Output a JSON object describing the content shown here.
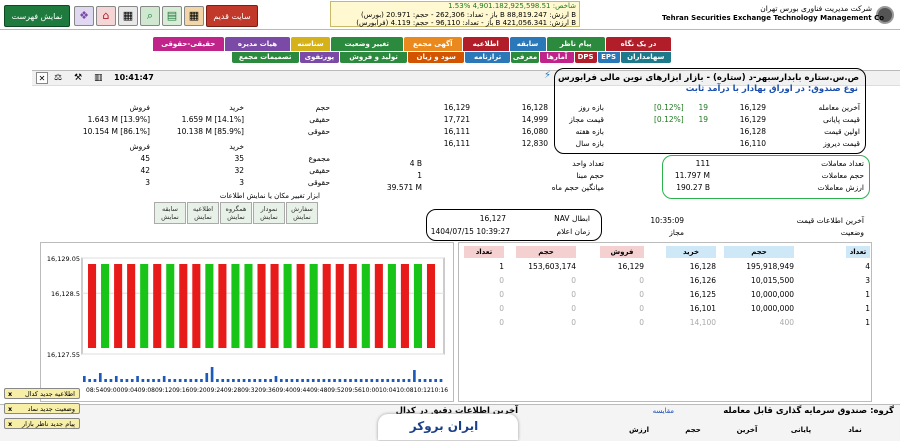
{
  "header": {
    "org_fa": "شرکت مدیریت فناوری بورس تهران",
    "org_en": "Tehran Securities Exchange Technology Management Co",
    "index_lines": [
      "شاخص: 4,901.182,925,598.51 %1.53",
      "(بورس) باز - تعداد: 262,306 - حجم: 20.971 B ارزش: 88,819.247 B",
      "(فرابورس) باز - تعداد: 96,110 - حجم: 4.119 B ارزش: 421,056.341 B"
    ],
    "old_site_label": "سایت قدیم",
    "show_list_label": "نمایش فهرست"
  },
  "tabs_row1": [
    {
      "label": "در یک نگاه",
      "color": "#b11e2a"
    },
    {
      "label": "پیام ناظر",
      "color": "#2b8a3e"
    },
    {
      "label": "سابقه",
      "color": "#2a78b8"
    },
    {
      "label": "اطلاعیه",
      "color": "#b11e2a"
    },
    {
      "label": "آگهی مجمع",
      "color": "#ea8a1e"
    },
    {
      "label": "تغییر وضعیت",
      "color": "#2b8a3e"
    },
    {
      "label": "سناسنه",
      "color": "#d6b21a"
    },
    {
      "label": "هیات مدیره",
      "color": "#7a4aa6"
    },
    {
      "label": "حقیقی-حقوقی",
      "color": "#c0238a"
    }
  ],
  "tabs_row2": [
    {
      "label": "سهامداران",
      "color": "#1e7a8a"
    },
    {
      "label": "EPS",
      "color": "#2a78b8"
    },
    {
      "label": "DPS",
      "color": "#b11e2a"
    },
    {
      "label": "آمارها",
      "color": "#c0238a"
    },
    {
      "label": "معرفی",
      "color": "#2b8a3e"
    },
    {
      "label": "ترازنامه",
      "color": "#2a78b8"
    },
    {
      "label": "سود و زیان",
      "color": "#d35400"
    },
    {
      "label": "تولید و فروش",
      "color": "#2b8a3e"
    },
    {
      "label": "پورتفوی",
      "color": "#7a4aa6"
    },
    {
      "label": "تصمیمات مجمع",
      "color": "#2b8a3e"
    }
  ],
  "time": "10:41:47",
  "title": "ص.س.ستاره بابدارسبهر-د (ستاره) - بازار ابزارهای نوین مالی فرابورس",
  "fund_type": "نوع صندوق: در اوراق بهادار با درآمد ثابت",
  "prices": {
    "last_trade_label": "آخرین معامله",
    "last_trade": "16,129",
    "last_trade_change": "19",
    "last_trade_pct": "[0.12%]",
    "closing_label": "قیمت پایانی",
    "closing": "16,129",
    "closing_change": "19",
    "closing_pct": "[0.12%]",
    "first_label": "اولین قیمت",
    "first": "16,128",
    "yesterday_label": "قیمت دیروز",
    "yesterday": "16,110",
    "day_range_label": "بازه روز",
    "day_range_low": "16,128",
    "day_range_high": "16,129",
    "allowed_label": "قیمت مجاز",
    "allowed_low": "14,999",
    "allowed_high": "17,721",
    "week_label": "بازه هفته",
    "week_low": "16,080",
    "week_high": "16,111",
    "year_label": "بازه سال",
    "year_low": "12,830",
    "year_high": "16,111"
  },
  "stats": {
    "count_label": "تعداد معاملات",
    "count": "111",
    "volume_label": "حجم معاملات",
    "volume": "11.797 M",
    "value_label": "ارزش معاملات",
    "value": "190.27 B",
    "unit_label": "تعداد واحد",
    "unit": "4 B",
    "base_label": "حجم مبنا",
    "base": "1",
    "avg_label": "میانگین حجم ماه",
    "avg": "39.571 M"
  },
  "nav": {
    "last_info_label": "آخرین اطلاعات قیمت",
    "last_info_time": "10:35:09",
    "status_label": "وضعیت",
    "status": "مجاز",
    "nav_label": "NAV ابطال",
    "nav": "16,127",
    "nav_time_label": "زمان اعلام",
    "nav_time": "1404/07/15 10:39:27"
  },
  "client": {
    "headers": [
      "حجم",
      "خرید",
      "فروش"
    ],
    "rows": [
      {
        "label": "حقیقی",
        "buy": "1.659 M [14.1%]",
        "sell": "1.643 M [13.9%]"
      },
      {
        "label": "حقوقی",
        "buy": "10.138 M [85.9%]",
        "sell": "10.154 M [86.1%]"
      }
    ],
    "count_headers": [
      "تعداد",
      "خرید",
      "فروش"
    ],
    "count_rows": [
      {
        "label": "مجموع",
        "buy": "35",
        "sell": "45"
      },
      {
        "label": "حقیقی",
        "buy": "32",
        "sell": "42"
      },
      {
        "label": "حقوقی",
        "buy": "3",
        "sell": "3"
      }
    ]
  },
  "option_hint": "ابزار تغییر مکان یا نمایش اطلاعات",
  "options": [
    {
      "label": "سفارش",
      "action": "نمایش"
    },
    {
      "label": "نمودار",
      "action": "نمایش"
    },
    {
      "label": "همگروه",
      "action": "نمایش"
    },
    {
      "label": "اطلاعیه",
      "action": "نمایش"
    },
    {
      "label": "سابقه",
      "action": "نمایش"
    }
  ],
  "orderbook": {
    "headers": [
      "تعداد",
      "حجم",
      "خرید",
      "فروش",
      "حجم",
      "تعداد"
    ],
    "rows": [
      [
        "4",
        "195,918,949",
        "16,128",
        "16,129",
        "153,603,174",
        "1"
      ],
      [
        "3",
        "10,015,500",
        "16,126",
        "0",
        "0",
        "0"
      ],
      [
        "1",
        "10,000,000",
        "16,125",
        "0",
        "0",
        "0"
      ],
      [
        "1",
        "10,000,000",
        "16,101",
        "0",
        "0",
        "0"
      ],
      [
        "1",
        "400",
        "14,100",
        "0",
        "0",
        "0"
      ]
    ]
  },
  "chart_data": {
    "type": "bar",
    "ylim": [
      16127.55,
      16129.05
    ],
    "yticks": [
      "16,129.05",
      "16,128.5",
      "16,127.55"
    ],
    "xticks": [
      "08:54",
      "09:00",
      "09:04",
      "09:08",
      "09:12",
      "09:16",
      "09:20",
      "09:24",
      "09:28",
      "09:32",
      "09:36",
      "09:40",
      "09:44",
      "09:48",
      "09:52",
      "09:56",
      "10:00",
      "10:04",
      "10:08",
      "10:12",
      "10:16"
    ],
    "candle_colors": [
      "red",
      "green",
      "red",
      "red",
      "green",
      "red",
      "green",
      "red",
      "red",
      "green",
      "red",
      "green",
      "green",
      "red",
      "red",
      "green",
      "red",
      "green",
      "red",
      "red",
      "red",
      "green",
      "red",
      "green",
      "red",
      "green",
      "red"
    ],
    "volume_bars": [
      2,
      1,
      1,
      3,
      1,
      1,
      2,
      1,
      1,
      1,
      2,
      1,
      1,
      1,
      1,
      2,
      1,
      1,
      1,
      1,
      1,
      1,
      1,
      3,
      5,
      1,
      1,
      1,
      1,
      1,
      1,
      1,
      1,
      1,
      1,
      1,
      2,
      1,
      1,
      1,
      1,
      1,
      1,
      1,
      1,
      1,
      1,
      1,
      1,
      1,
      1,
      1,
      1,
      1,
      1,
      1,
      1,
      1,
      1,
      1,
      1,
      1,
      4,
      1,
      1,
      1,
      1,
      1
    ]
  },
  "notices": [
    "اطلاعیه جدید کدال",
    "وضعیت جدید نماد",
    "پیام جدید ناظر بازار"
  ],
  "bottom": {
    "group_label": "گروه: صندوق سرمایه گذاری قابل معامله",
    "cmp_label": "مقایسه",
    "kodal_label": "آخرین اطلاعات دقیق در کدال",
    "cols": [
      "نماد",
      "پایانی",
      "آخرین",
      "حجم",
      "ارزش"
    ],
    "brand": "ایران بروکر"
  }
}
